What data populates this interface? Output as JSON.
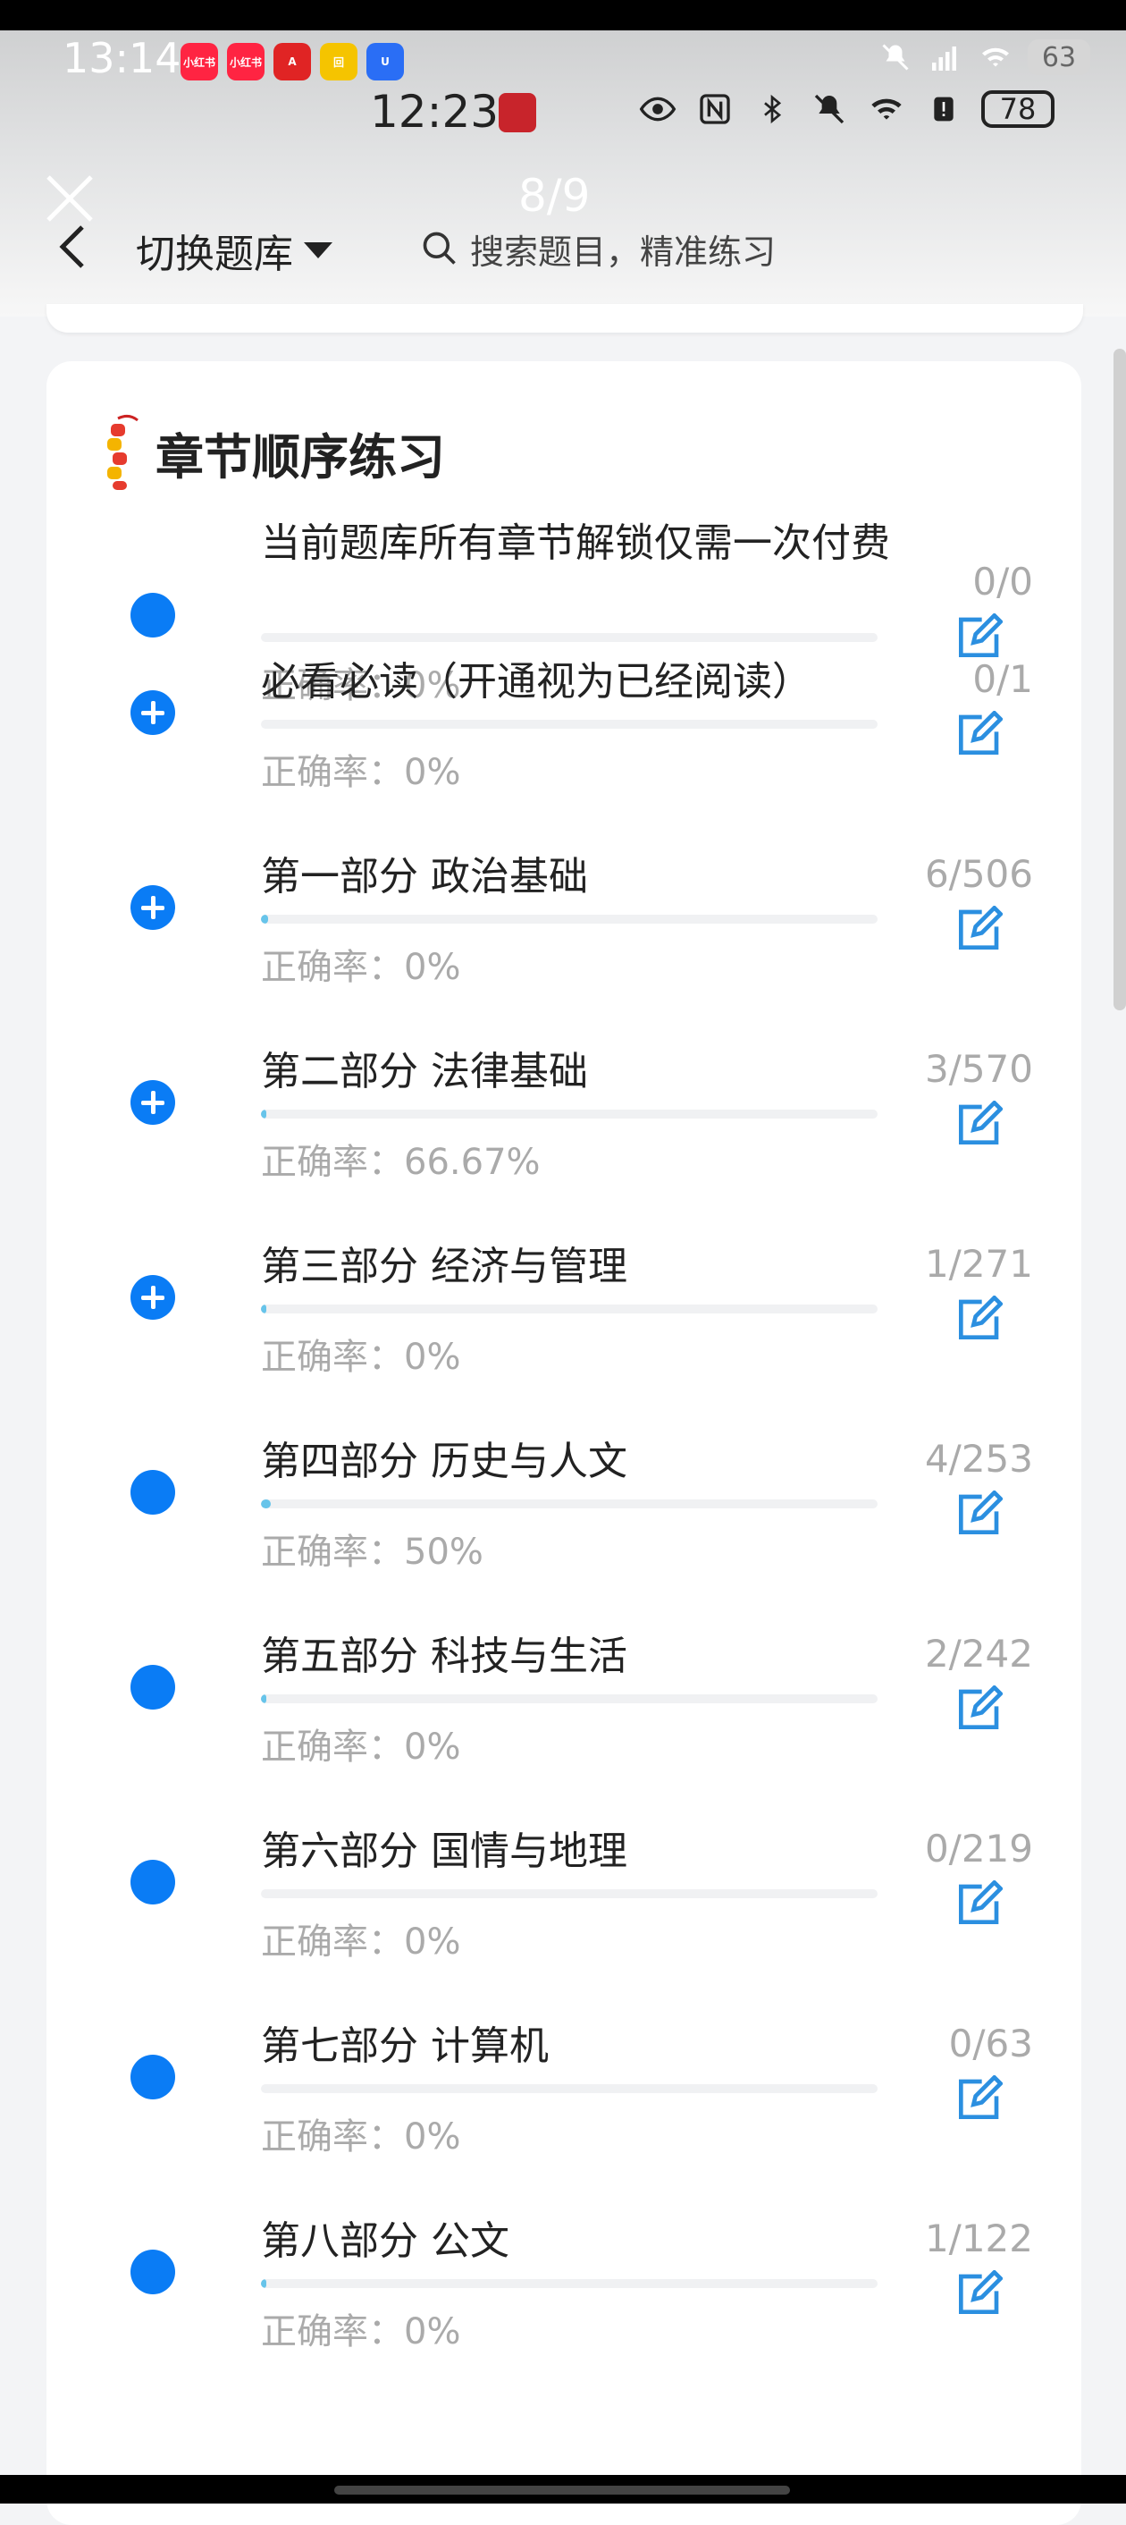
{
  "outer_status": {
    "time": "13:14",
    "apps": [
      {
        "name": "xiaohongshu-1",
        "label": "小红书",
        "color": "#ff2442"
      },
      {
        "name": "xiaohongshu-2",
        "label": "小红书",
        "color": "#ff2442"
      },
      {
        "name": "app-a",
        "label": "A",
        "color": "#e02424"
      },
      {
        "name": "app-yellow",
        "label": "回",
        "color": "#f5c400"
      },
      {
        "name": "app-blue",
        "label": "U",
        "color": "#2a6ef5"
      }
    ],
    "network": "5G",
    "battery": "63"
  },
  "inner_status": {
    "time": "12:23",
    "battery": "78"
  },
  "header": {
    "page_indicator": "8/9",
    "switch_bank_label": "切换题库",
    "search_placeholder": "搜索题目，精准练习"
  },
  "section": {
    "title": "章节顺序练习"
  },
  "chapters": [
    {
      "title": "当前题库所有章节解锁仅需一次付费",
      "accuracy_label": "正确率：",
      "accuracy": "0%",
      "count": "0/0",
      "progress": 0,
      "bullet": "dot"
    },
    {
      "title": "必看必读（开通视为已经阅读）",
      "accuracy_label": "正确率：",
      "accuracy": "0%",
      "count": "0/1",
      "progress": 0,
      "bullet": "plus"
    },
    {
      "title": "第一部分 政治基础",
      "accuracy_label": "正确率：",
      "accuracy": "0%",
      "count": "6/506",
      "progress": 0.012,
      "bullet": "plus"
    },
    {
      "title": "第二部分 法律基础",
      "accuracy_label": "正确率：",
      "accuracy": "66.67%",
      "count": "3/570",
      "progress": 0.005,
      "bullet": "plus"
    },
    {
      "title": "第三部分 经济与管理",
      "accuracy_label": "正确率：",
      "accuracy": "0%",
      "count": "1/271",
      "progress": 0.004,
      "bullet": "plus"
    },
    {
      "title": "第四部分 历史与人文",
      "accuracy_label": "正确率：",
      "accuracy": "50%",
      "count": "4/253",
      "progress": 0.016,
      "bullet": "dot"
    },
    {
      "title": "第五部分 科技与生活",
      "accuracy_label": "正确率：",
      "accuracy": "0%",
      "count": "2/242",
      "progress": 0.008,
      "bullet": "dot"
    },
    {
      "title": "第六部分 国情与地理",
      "accuracy_label": "正确率：",
      "accuracy": "0%",
      "count": "0/219",
      "progress": 0,
      "bullet": "dot"
    },
    {
      "title": "第七部分 计算机",
      "accuracy_label": "正确率：",
      "accuracy": "0%",
      "count": "0/63",
      "progress": 0,
      "bullet": "dot"
    },
    {
      "title": "第八部分 公文",
      "accuracy_label": "正确率：",
      "accuracy": "0%",
      "count": "1/122",
      "progress": 0.008,
      "bullet": "dot"
    }
  ],
  "colors": {
    "accent": "#0a7cf5",
    "edit_icon": "#2b8fe0",
    "progress_fill": "#67c4ea",
    "muted_text": "#aaaaaa"
  }
}
